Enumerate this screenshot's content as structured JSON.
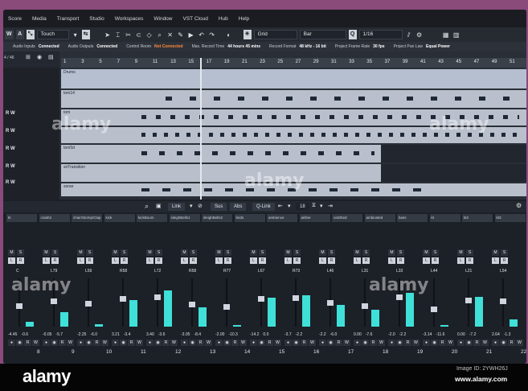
{
  "menu": [
    "Score",
    "Media",
    "Transport",
    "Studio",
    "Workspaces",
    "Window",
    "VST Cloud",
    "Hub",
    "Help"
  ],
  "toolbar": {
    "modes": [
      "W",
      "A"
    ],
    "automation_mode": "Touch",
    "snap_type": "Grid",
    "grid_value": "Bar",
    "quantize_label": "Q",
    "quantize_value": "1/16"
  },
  "status": [
    {
      "label": "Audio Inputs",
      "value": "Connected"
    },
    {
      "label": "Audio Outputs",
      "value": "Connected"
    },
    {
      "label": "Control Room",
      "value": "Not Connected",
      "warn": true
    },
    {
      "label": "Max. Record Time",
      "value": "44 hours 45 mins"
    },
    {
      "label": "Record Format",
      "value": "48 kHz - 16 bit"
    },
    {
      "label": "Project Frame Rate",
      "value": "30 fps"
    },
    {
      "label": "Project Pan Law",
      "value": "Equal Power"
    }
  ],
  "arrangement": {
    "track_counter": "4 / 46",
    "ruler": [
      "1",
      "3",
      "5",
      "7",
      "9",
      "11",
      "13",
      "15",
      "17",
      "19",
      "21",
      "23",
      "25",
      "27",
      "29",
      "31",
      "33",
      "35",
      "37",
      "39",
      "41",
      "43",
      "45",
      "47",
      "49",
      "51",
      "53"
    ],
    "lanes": [
      {
        "label": "Drums"
      },
      {
        "label": "tom14"
      },
      {
        "label": "tom"
      },
      {
        "label": ""
      },
      {
        "label": "tom5d"
      },
      {
        "label": "sirTransition"
      },
      {
        "label": "sonar"
      }
    ],
    "rw_rows": [
      "R W",
      "R W",
      "R W",
      "R W",
      "R W"
    ]
  },
  "mixer": {
    "toolbar": {
      "link": "Link",
      "sus": "Sus",
      "abs": "Abs",
      "qlink": "Q-Link",
      "page": "18"
    },
    "channel_names": [
      "kt",
      "crash2",
      "chair/Stomp/Clap",
      "kick",
      "kickBoom",
      "sleighBells1",
      "sleighBells2",
      "birds",
      "ambience",
      "airline",
      "ostShed",
      "ambiosted",
      "bass",
      "kt",
      "kt2",
      "kt3"
    ],
    "strips": [
      {
        "pan": "C",
        "vol": "-4.45",
        "peak": "-0.6",
        "meter": 0.1,
        "fader": 0.55,
        "num": "8"
      },
      {
        "pan": "L79",
        "vol": "-0.05",
        "peak": "-5.7",
        "meter": 0.3,
        "fader": 0.45,
        "num": "9"
      },
      {
        "pan": "L59",
        "vol": "-2.25",
        "peak": "-6.0",
        "meter": 0.05,
        "fader": 0.5,
        "num": "10"
      },
      {
        "pan": "R58",
        "vol": "3.21",
        "peak": "-3.4",
        "meter": 0.55,
        "fader": 0.4,
        "num": "11"
      },
      {
        "pan": "L72",
        "vol": "3.40",
        "peak": "-3.6",
        "meter": 0.75,
        "fader": 0.35,
        "num": "12"
      },
      {
        "pan": "R58",
        "vol": "-3.05",
        "peak": "-8.4",
        "meter": 0.4,
        "fader": 0.52,
        "num": "13"
      },
      {
        "pan": "R77",
        "vol": "-2.00",
        "peak": "-10.3",
        "meter": 0.02,
        "fader": 0.58,
        "num": "14"
      },
      {
        "pan": "L67",
        "vol": "-14.2",
        "peak": "0.0",
        "meter": 0.6,
        "fader": 0.4,
        "num": "15"
      },
      {
        "pan": "R73",
        "vol": "-3.7",
        "peak": "-2.2",
        "meter": 0.65,
        "fader": 0.38,
        "num": "16"
      },
      {
        "pan": "L46",
        "vol": "-2.2",
        "peak": "-6.0",
        "meter": 0.45,
        "fader": 0.48,
        "num": "17"
      },
      {
        "pan": "L31",
        "vol": "0.00",
        "peak": "-7.6",
        "meter": 0.35,
        "fader": 0.55,
        "num": "18"
      },
      {
        "pan": "L33",
        "vol": "-2.0",
        "peak": "-2.2",
        "meter": 0.7,
        "fader": 0.35,
        "num": "19"
      },
      {
        "pan": "L44",
        "vol": "-3.14",
        "peak": "-11.6",
        "meter": 0.02,
        "fader": 0.62,
        "num": "20"
      },
      {
        "pan": "L21",
        "vol": "0.00",
        "peak": "-7.2",
        "meter": 0.62,
        "fader": 0.42,
        "num": "21"
      },
      {
        "pan": "L54",
        "vol": "2.64",
        "peak": "-1.3",
        "meter": 0.15,
        "fader": 0.45,
        "num": "22"
      }
    ]
  },
  "watermark": "alamy",
  "footer": {
    "logo": "alamy",
    "image_id": "Image ID: 2YWH26J",
    "site": "www.alamy.com"
  }
}
